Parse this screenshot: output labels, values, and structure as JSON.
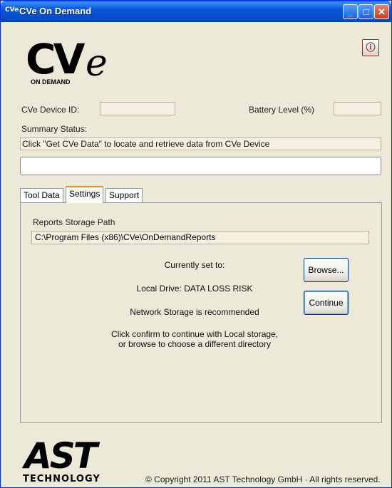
{
  "window": {
    "icon_text": "CVe",
    "title": "CVe On Demand",
    "minimize_label": "_",
    "maximize_label": "□",
    "close_label": "✕"
  },
  "logo": {
    "main": "CV",
    "e_letter": "e",
    "sub": "ON DEMAND"
  },
  "info_button": {
    "glyph": "ⓘ",
    "icon": "info-icon"
  },
  "device": {
    "id_label": "CVe Device ID:",
    "id_value": "",
    "battery_label": "Battery Level (%)",
    "battery_value": ""
  },
  "summary": {
    "label": "Summary Status:",
    "status_text": "Click \"Get CVe Data\" to locate and retrieve data from CVe Device",
    "detail_value": ""
  },
  "tabs": [
    {
      "label": "Tool Data",
      "active": false
    },
    {
      "label": "Settings",
      "active": true
    },
    {
      "label": "Support",
      "active": false
    }
  ],
  "settings": {
    "path_label": "Reports Storage Path",
    "path_value": "C:\\Program Files (x86)\\CVe\\OnDemandReports",
    "currently_set": "Currently set to:",
    "local_drive": "Local Drive: DATA LOSS RISK",
    "network_rec": "Network Storage is recommended",
    "instruction_line1": "Click confirm to continue with Local storage,",
    "instruction_line2": "or browse to choose a different directory",
    "browse_label": "Browse...",
    "continue_label": "Continue"
  },
  "footer": {
    "logo_main": "AST",
    "logo_sub": "TECHNOLOGY",
    "copyright": "© Copyright 2011 AST Technology GmbH · All rights reserved."
  },
  "colors": {
    "titlebar": "#0a58d6",
    "window_bg": "#ece9d8",
    "field_bg": "#f5f0e1",
    "active_tab_accent": "#e68b2c"
  }
}
